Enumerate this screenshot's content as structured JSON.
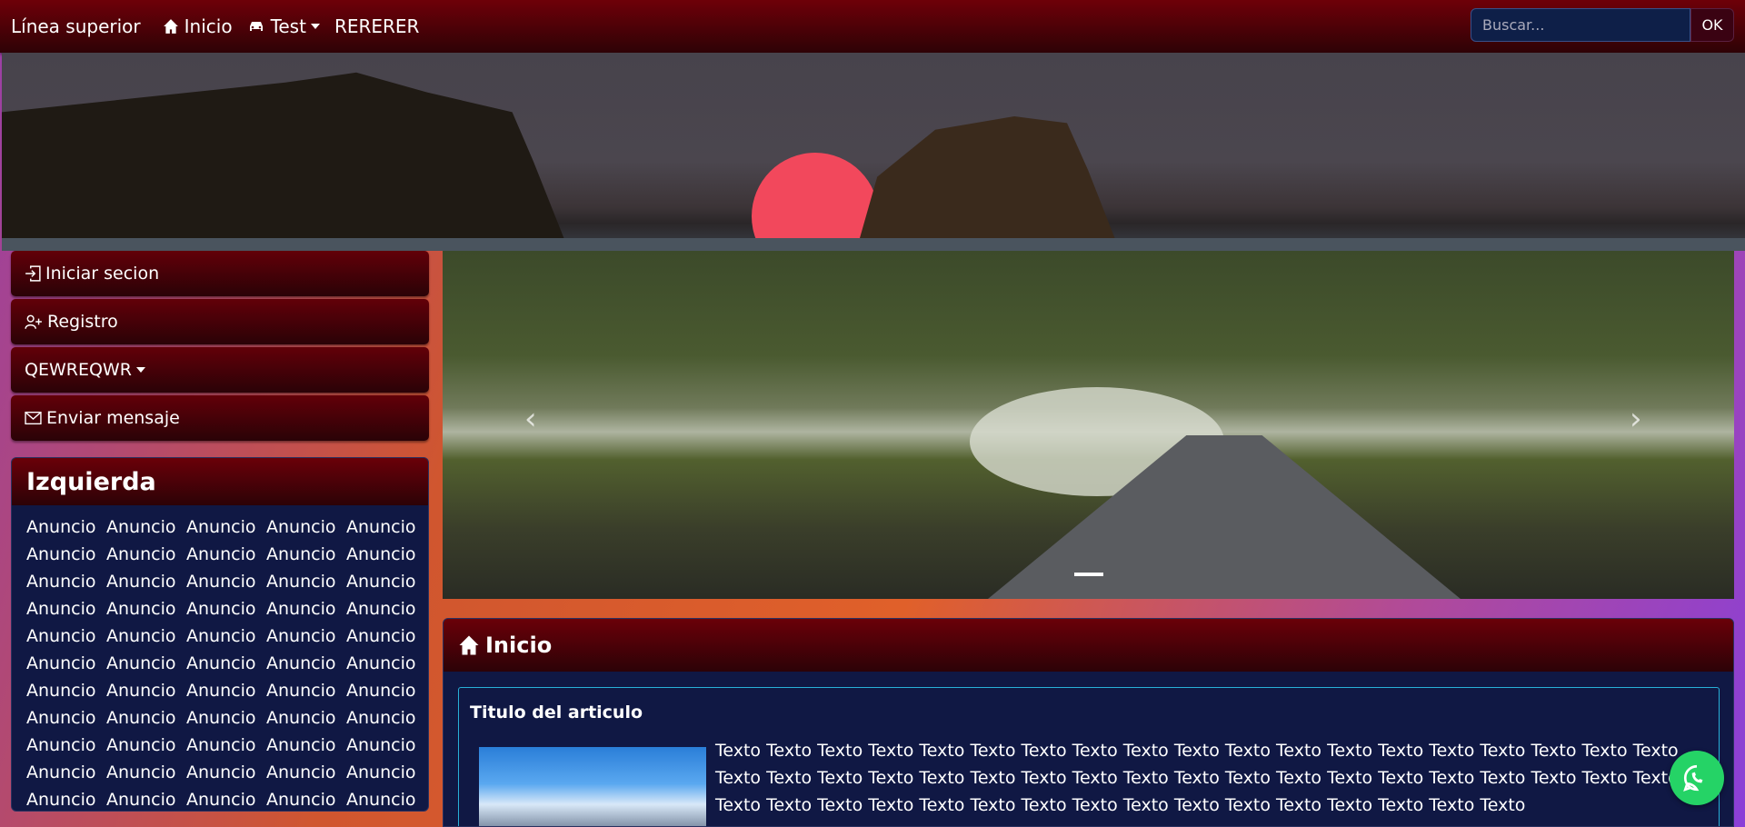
{
  "topbar": {
    "brand": "Línea superior",
    "nav": [
      {
        "label": "Inicio",
        "icon": "house-icon"
      },
      {
        "label": "Test",
        "icon": "car-icon",
        "dropdown": true
      },
      {
        "label": "RERERER"
      }
    ],
    "search_placeholder": "Buscar...",
    "search_button": "OK"
  },
  "sidebar": {
    "buttons": [
      {
        "label": "Iniciar secion",
        "icon": "login-icon"
      },
      {
        "label": "Registro",
        "icon": "user-plus-icon"
      },
      {
        "label": "QEWREQWR",
        "dropdown": true
      },
      {
        "label": "Enviar mensaje",
        "icon": "envelope-icon"
      }
    ],
    "panel_title": "Izquierda",
    "ad_label": "Anuncio",
    "ad_rows": 11,
    "ad_cols": 5
  },
  "carousel": {
    "prev": "‹",
    "next": "›"
  },
  "content": {
    "title": "Inicio",
    "article_title": "Titulo del articulo",
    "article_text": "Texto Texto Texto Texto Texto Texto Texto Texto Texto Texto Texto Texto Texto Texto Texto Texto Texto Texto Texto Texto Texto Texto Texto Texto Texto Texto Texto Texto Texto Texto Texto Texto Texto Texto Texto Texto Texto Texto Texto Texto Texto Texto Texto Texto Texto Texto Texto Texto Texto Texto Texto Texto Texto Texto"
  },
  "colors": {
    "navbar": "#6e0008",
    "panel": "#101844",
    "accent": "#28b0d8",
    "whatsapp": "#25d366"
  }
}
